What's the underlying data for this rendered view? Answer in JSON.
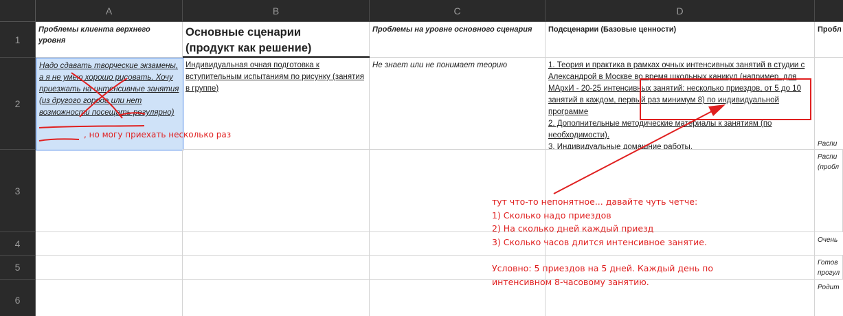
{
  "columns": [
    "A",
    "B",
    "C",
    "D"
  ],
  "rows": [
    "1",
    "2",
    "3",
    "4",
    "5",
    "6"
  ],
  "header": {
    "a": "Проблемы клиента верхнего уровня",
    "b_line1": "Основные сценарии",
    "b_line2": "(продукт как решение)",
    "c": "Проблемы на уровне основного сценария",
    "d": "Подсценарии (Базовые ценности)",
    "e": "Пробл"
  },
  "row2": {
    "a": "Надо сдавать творческие экзамены, а я не умею хорошо рисовать. Хочу приезжать на интенсивные занятия (из другого города или нет возможности посещать регулярно)",
    "a_annotation": ", но могу приехать несколько раз",
    "b": "Индивидуальная очная подготовка к вступительным испытаниям по рисунку (занятия в группе)",
    "c": "Не знает или не понимает теорию",
    "d1": "1. Теория и практика в рамках очных интенсивных  занятий в студии с Александрой в Москве во время школьных каникул (например, для МАрхИ - 20-25 интенсивных занятий: несколько приездов, от 5 до 10 занятий в каждом, первый раз минимум 8) по индивидуальной программе",
    "d2": "2. Дополнительные методические материалы к занятиям (по необходимости).",
    "d3": "3. Индивидуальные домашние работы.",
    "e": "Распи"
  },
  "row3": {
    "e": "Распи (пробл"
  },
  "row4": {
    "e": "Очень"
  },
  "row5": {
    "e": "Готов прогул"
  },
  "row6": {
    "e": "Родит"
  },
  "annotation": {
    "line1": "тут что-то непонятное... давайте чуть четче:",
    "line2": "1) Сколько надо приездов",
    "line3": "2) На сколько дней каждый приезд",
    "line4": "3) Сколько часов длится интенсивное занятие.",
    "line5": "Условно: 5 приездов на 5 дней. Каждый день по",
    "line6": "интенсивном 8-часовому занятию."
  },
  "colors": {
    "annotation": "#e02020",
    "selection": "#cfe2f8",
    "selection_border": "#4a86e8",
    "header_bg": "#2a2a2a"
  }
}
